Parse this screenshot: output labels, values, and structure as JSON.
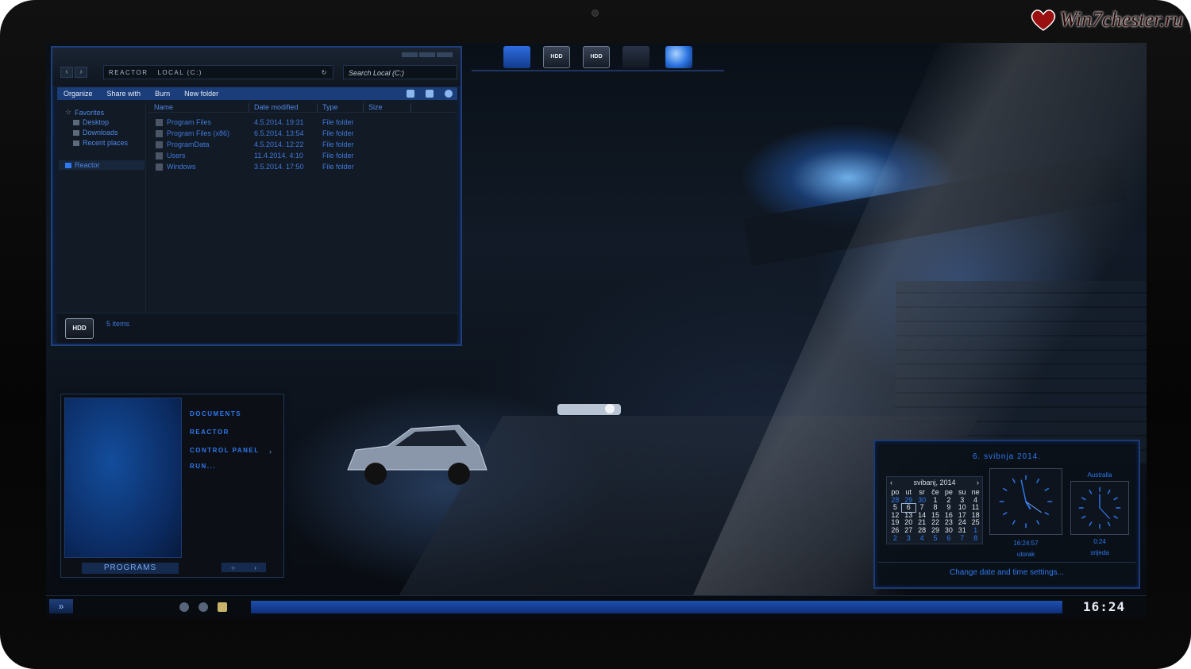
{
  "watermark": "Win7chester.ru",
  "explorer": {
    "address": [
      "Reactor",
      "Local (C:)"
    ],
    "search_placeholder": "Search Local (C:)",
    "toolbar": [
      "Organize",
      "Share with",
      "Burn",
      "New folder"
    ],
    "nav": {
      "favorites": "Favorites",
      "items": [
        "Desktop",
        "Downloads",
        "Recent places"
      ],
      "computer": "Reactor"
    },
    "columns": [
      "Name",
      "Date modified",
      "Type",
      "Size"
    ],
    "rows": [
      {
        "name": "Program Files",
        "date": "4.5.2014. 19:31",
        "type": "File folder"
      },
      {
        "name": "Program Files (x86)",
        "date": "6.5.2014. 13:54",
        "type": "File folder"
      },
      {
        "name": "ProgramData",
        "date": "4.5.2014. 12:22",
        "type": "File folder"
      },
      {
        "name": "Users",
        "date": "11.4.2014. 4:10",
        "type": "File folder"
      },
      {
        "name": "Windows",
        "date": "3.5.2014. 17:50",
        "type": "File folder"
      }
    ],
    "status": "5 items",
    "drive_badge": "HDD"
  },
  "dock": {
    "hdd1": "HDD",
    "hdd2": "HDD"
  },
  "startmenu": {
    "links": [
      "Documents",
      "Reactor",
      "Control Panel",
      "Run..."
    ],
    "programs": "PROGRAMS"
  },
  "gadget": {
    "date_title": "6. svibnja 2014.",
    "month": "svibanj, 2014",
    "weekdays": [
      "po",
      "ut",
      "sr",
      "če",
      "pe",
      "su",
      "ne"
    ],
    "days": [
      [
        "28",
        "29",
        "30",
        "1",
        "2",
        "3",
        "4"
      ],
      [
        "5",
        "6",
        "7",
        "8",
        "9",
        "10",
        "11"
      ],
      [
        "12",
        "13",
        "14",
        "15",
        "16",
        "17",
        "18"
      ],
      [
        "19",
        "20",
        "21",
        "22",
        "23",
        "24",
        "25"
      ],
      [
        "26",
        "27",
        "28",
        "29",
        "30",
        "31",
        "1"
      ],
      [
        "2",
        "3",
        "4",
        "5",
        "6",
        "7",
        "8"
      ]
    ],
    "clock1": {
      "time": "16:24:57",
      "day": "utorak"
    },
    "clock2": {
      "city": "Australia",
      "time": "0:24",
      "day": "srijeda"
    },
    "footer": "Change date and time settings..."
  },
  "taskbar": {
    "clock": "16:24"
  },
  "colors": {
    "accent": "#2f78f0",
    "panel": "#121a25",
    "border": "#1f3f7a"
  }
}
